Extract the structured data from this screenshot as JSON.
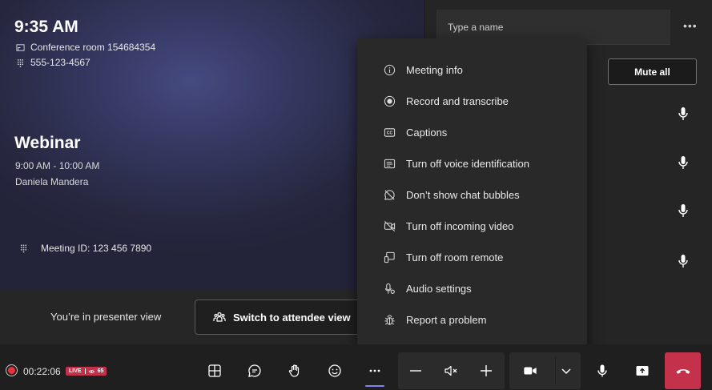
{
  "stage": {
    "time": "9:35 AM",
    "room": "Conference room 154684354",
    "phone": "555-123-4567",
    "webinar": {
      "title": "Webinar",
      "time": "9:00 AM - 10:00 AM",
      "host": "Daniela Mandera"
    },
    "meeting_id": "Meeting ID: 123 456 7890"
  },
  "presenter_bar": {
    "status": "You’re in presenter view",
    "switch_label": "Switch to attendee view"
  },
  "participants_panel": {
    "search_placeholder": "Type a name",
    "more_label": "•••",
    "mute_all_label": "Mute all",
    "participant_count": 4
  },
  "menu": {
    "items": [
      {
        "label": "Meeting info",
        "icon": "info-icon"
      },
      {
        "label": "Record and transcribe",
        "icon": "record-icon"
      },
      {
        "label": "Captions",
        "icon": "captions-icon"
      },
      {
        "label": "Turn off voice identification",
        "icon": "voice-id-icon"
      },
      {
        "label": "Don’t show chat bubbles",
        "icon": "chat-bubble-off-icon"
      },
      {
        "label": "Turn off incoming video",
        "icon": "video-off-icon"
      },
      {
        "label": "Turn off room remote",
        "icon": "room-remote-icon"
      },
      {
        "label": "Audio settings",
        "icon": "audio-settings-icon"
      },
      {
        "label": "Report a problem",
        "icon": "bug-icon"
      }
    ]
  },
  "toolbar": {
    "timer": "00:22:06",
    "live_label": "LIVE",
    "viewer_count": "65",
    "colors": {
      "accent": "#7f85f5",
      "end_call": "#c4314b",
      "record": "#e8333f"
    }
  }
}
